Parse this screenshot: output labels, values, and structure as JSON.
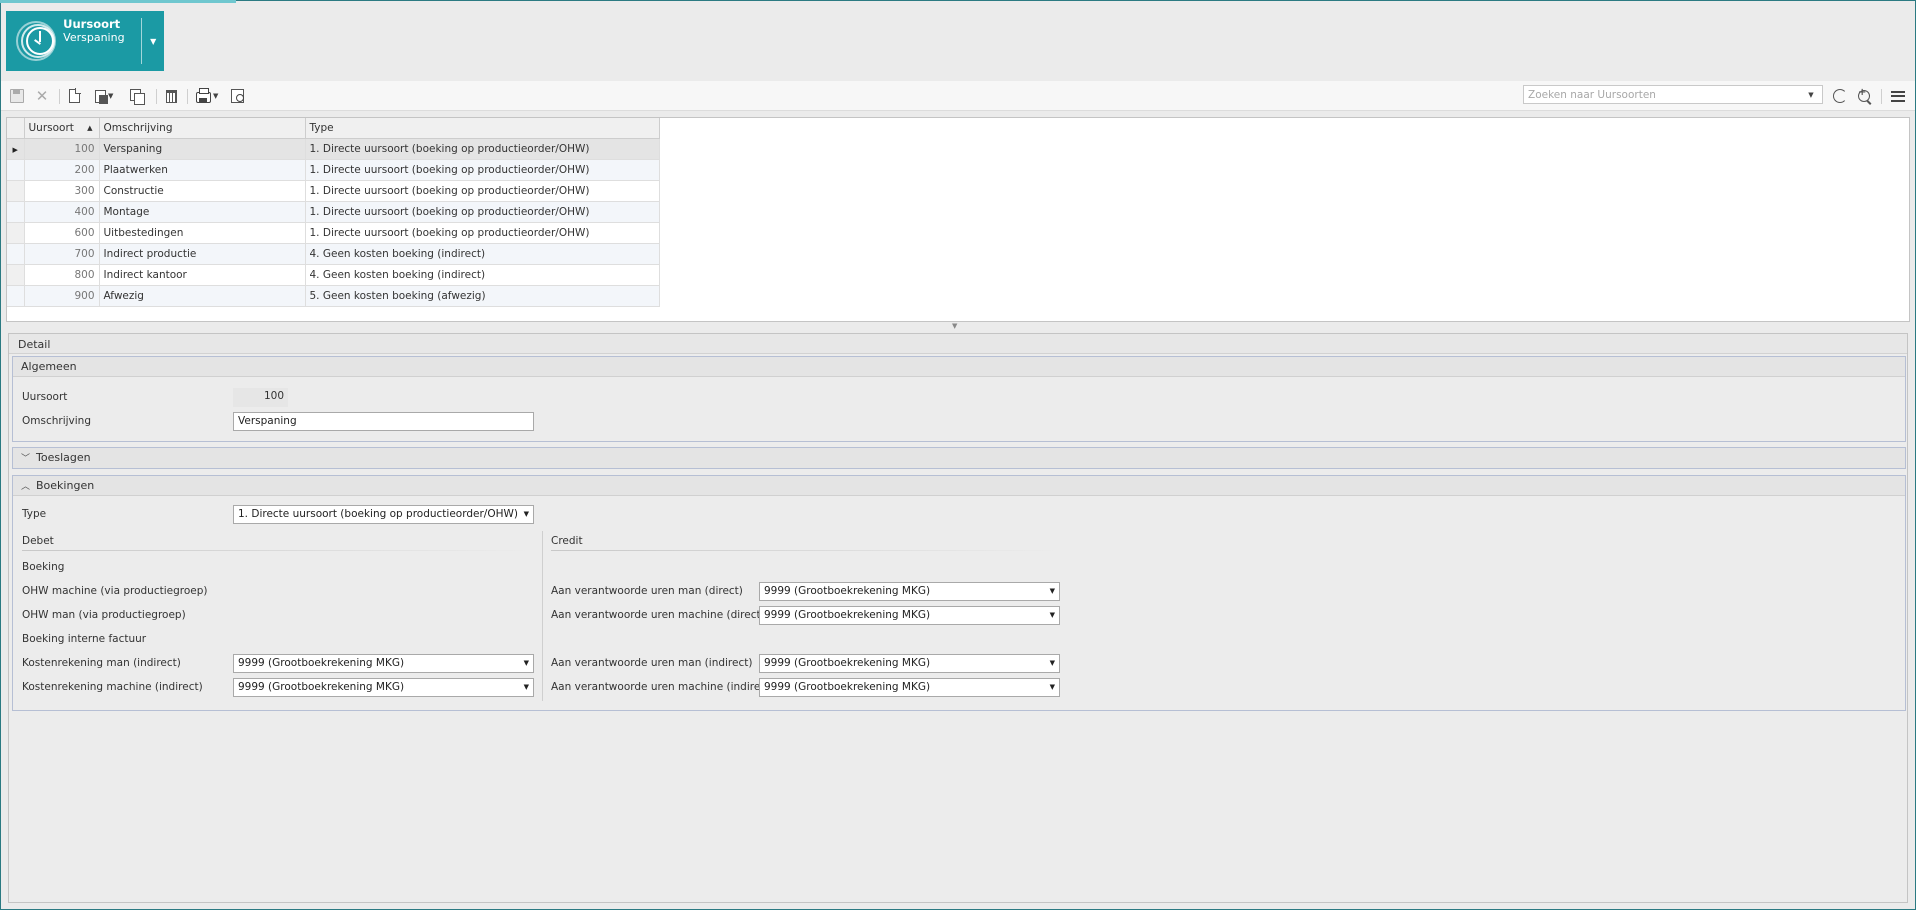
{
  "app": {
    "title": "Uursoort",
    "subtitle": "Verspaning"
  },
  "toolbar": {
    "search_placeholder": "Zoeken naar Uursoorten",
    "icons": [
      "save-icon",
      "cancel-icon",
      "new-document-icon",
      "paste-icon",
      "copy-icon",
      "delete-icon",
      "print-icon",
      "print-preview-icon",
      "refresh-icon",
      "zoom-add-icon",
      "menu-icon"
    ]
  },
  "grid": {
    "columns": [
      "Uursoort",
      "Omschrijving",
      "Type"
    ],
    "rows": [
      {
        "code": "100",
        "desc": "Verspaning",
        "type": "1. Directe uursoort (boeking op productieorder/OHW)"
      },
      {
        "code": "200",
        "desc": "Plaatwerken",
        "type": "1. Directe uursoort (boeking op productieorder/OHW)"
      },
      {
        "code": "300",
        "desc": "Constructie",
        "type": "1. Directe uursoort (boeking op productieorder/OHW)"
      },
      {
        "code": "400",
        "desc": "Montage",
        "type": "1. Directe uursoort (boeking op productieorder/OHW)"
      },
      {
        "code": "600",
        "desc": "Uitbestedingen",
        "type": "1. Directe uursoort (boeking op productieorder/OHW)"
      },
      {
        "code": "700",
        "desc": "Indirect productie",
        "type": "4. Geen kosten boeking (indirect)"
      },
      {
        "code": "800",
        "desc": "Indirect kantoor",
        "type": "4. Geen kosten boeking (indirect)"
      },
      {
        "code": "900",
        "desc": "Afwezig",
        "type": "5. Geen kosten boeking (afwezig)"
      }
    ]
  },
  "detail": {
    "title": "Detail",
    "algemeen": {
      "title": "Algemeen",
      "uursoort_label": "Uursoort",
      "uursoort_value": "100",
      "omschrijving_label": "Omschrijving",
      "omschrijving_value": "Verspaning"
    },
    "toeslagen": {
      "title": "Toeslagen"
    },
    "boekingen": {
      "title": "Boekingen",
      "type_label": "Type",
      "type_value": "1. Directe uursoort (boeking op productieorder/OHW)",
      "debet": "Debet",
      "credit": "Credit",
      "boeking": "Boeking",
      "ohw_machine": "OHW machine (via productiegroep)",
      "ohw_man": "OHW man (via productiegroep)",
      "boeking_interne": "Boeking interne factuur",
      "kosten_man_label": "Kostenrekening man (indirect)",
      "kosten_man_value": "9999 (Grootboekrekening MKG)",
      "kosten_machine_label": "Kostenrekening machine (indirect)",
      "kosten_machine_value": "9999 (Grootboekrekening MKG)",
      "credit_man_direct_label": "Aan verantwoorde uren man (direct)",
      "credit_man_direct_value": "9999 (Grootboekrekening MKG)",
      "credit_machine_direct_label": "Aan verantwoorde uren machine (direct)",
      "credit_machine_direct_value": "9999 (Grootboekrekening MKG)",
      "credit_man_indirect_label": "Aan verantwoorde uren man (indirect)",
      "credit_man_indirect_value": "9999 (Grootboekrekening MKG)",
      "credit_machine_indirect_label": "Aan verantwoorde uren machine (indirect)",
      "credit_machine_indirect_value": "9999 (Grootboekrekening MKG)"
    }
  },
  "colors": {
    "accent": "#1b9aa4",
    "frame": "#2b7a82"
  }
}
